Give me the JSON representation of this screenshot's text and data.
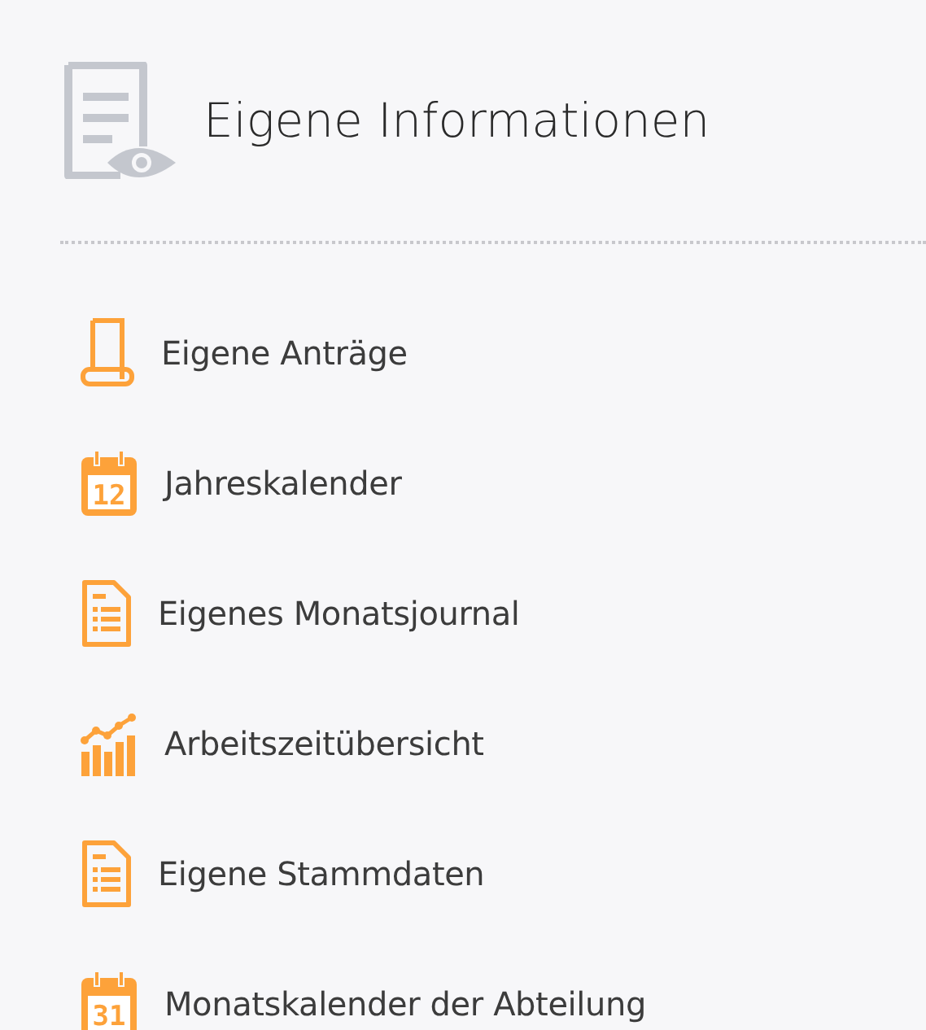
{
  "header": {
    "title": "Eigene Informationen"
  },
  "items": [
    {
      "kind": "scroll",
      "label": "Eigene Anträge"
    },
    {
      "kind": "calendar",
      "day": "12",
      "label": "Jahreskalender"
    },
    {
      "kind": "document",
      "label": "Eigenes Monatsjournal"
    },
    {
      "kind": "chart",
      "label": "Arbeitszeitübersicht"
    },
    {
      "kind": "document",
      "label": "Eigene Stammdaten"
    },
    {
      "kind": "calendar",
      "day": "31",
      "label": "Monatskalender der Abteilung"
    }
  ]
}
